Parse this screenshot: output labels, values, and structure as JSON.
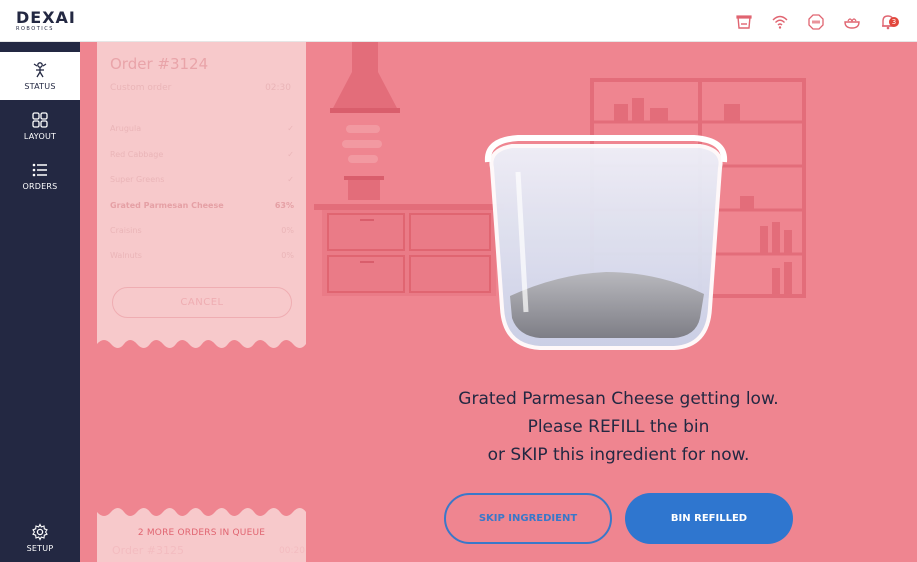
{
  "brand": {
    "logo_text": "DEXAI",
    "logo_sub": "ROBOTICS"
  },
  "topbar": {
    "icons": [
      "bin-icon",
      "wifi-icon",
      "stop-icon",
      "bowl-icon",
      "notification-bell-icon"
    ],
    "notification_count": "3"
  },
  "sidebar": {
    "items": [
      {
        "label": "STATUS",
        "icon": "robot-arm-icon",
        "active": true
      },
      {
        "label": "LAYOUT",
        "icon": "grid-icon",
        "active": false
      },
      {
        "label": "ORDERS",
        "icon": "list-icon",
        "active": false
      }
    ],
    "setup_label": "SETUP"
  },
  "order": {
    "title": "Order #3124",
    "subtitle": "Custom order",
    "time": "02:30",
    "ingredients": [
      {
        "name": "Arugula",
        "status": "✓",
        "done": true
      },
      {
        "name": "Red Cabbage",
        "status": "✓",
        "done": true
      },
      {
        "name": "Super Greens",
        "status": "✓",
        "done": true
      },
      {
        "name": "Grated Parmesan Cheese",
        "status": "63%",
        "done": false
      },
      {
        "name": "Craisins",
        "status": "0%",
        "done": false
      },
      {
        "name": "Walnuts",
        "status": "0%",
        "done": false
      }
    ],
    "cancel_label": "CANCEL"
  },
  "queue": {
    "label": "2 MORE ORDERS IN QUEUE",
    "next_order": "Order #3125",
    "next_time": "00:20"
  },
  "alert": {
    "line1": "Grated Parmesan Cheese getting low.",
    "line2": "Please REFILL the bin",
    "line3": "or SKIP this ingredient for now.",
    "skip_label": "SKIP INGREDIENT",
    "refill_label": "BIN REFILLED",
    "bin_fill_level": 0.2
  },
  "colors": {
    "background": "#ef8590",
    "sidebar": "#232842",
    "accent_blue": "#2f76cf",
    "badge": "#e2473c"
  }
}
